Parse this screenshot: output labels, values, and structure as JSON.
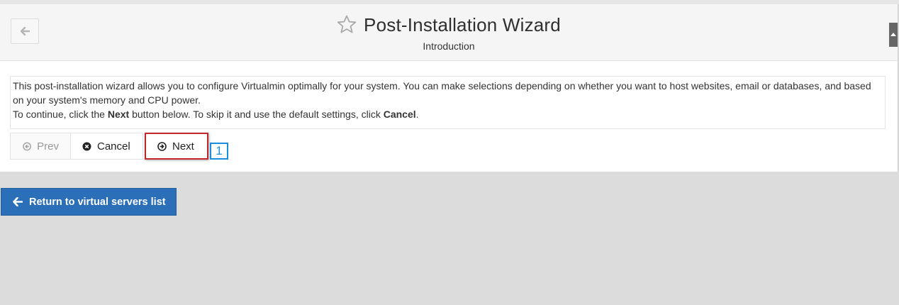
{
  "header": {
    "title": "Post-Installation Wizard",
    "subtitle": "Introduction",
    "back_icon": "arrow-left-icon",
    "favorite_icon": "star-outline-icon"
  },
  "intro": {
    "paragraph1": "This post-installation wizard allows you to configure Virtualmin optimally for your system. You can make selections depending on whether you want to host websites, email or databases, and based on your system's memory and CPU power.",
    "paragraph2_before_next": "To continue, click the ",
    "next_word": "Next",
    "paragraph2_between": " button below. To skip it and use the default settings, click ",
    "cancel_word": "Cancel",
    "paragraph2_end": "."
  },
  "wizard_buttons": {
    "prev_label": "Prev",
    "cancel_label": "Cancel",
    "next_label": "Next"
  },
  "annotation": {
    "marker_label": "1",
    "marker_color": "#1a8fe0",
    "highlight_color": "#c0282c"
  },
  "footer": {
    "return_label": "Return to virtual servers list",
    "return_color": "#2a6fb7"
  }
}
